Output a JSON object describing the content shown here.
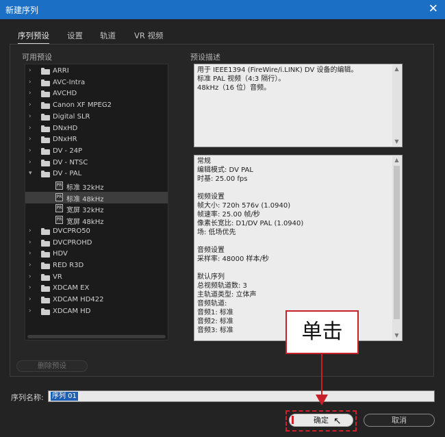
{
  "window": {
    "title": "新建序列",
    "close_glyph": "✕"
  },
  "tabs": [
    {
      "label": "序列预设"
    },
    {
      "label": "设置"
    },
    {
      "label": "轨道"
    },
    {
      "label": "VR 视频"
    }
  ],
  "presets": {
    "section_label": "可用预设",
    "items": [
      {
        "label": "ARRI",
        "type": "folder",
        "expanded": false
      },
      {
        "label": "AVC-Intra",
        "type": "folder",
        "expanded": false
      },
      {
        "label": "AVCHD",
        "type": "folder",
        "expanded": false
      },
      {
        "label": "Canon XF MPEG2",
        "type": "folder",
        "expanded": false
      },
      {
        "label": "Digital SLR",
        "type": "folder",
        "expanded": false
      },
      {
        "label": "DNxHD",
        "type": "folder",
        "expanded": false
      },
      {
        "label": "DNxHR",
        "type": "folder",
        "expanded": false
      },
      {
        "label": "DV - 24P",
        "type": "folder",
        "expanded": false
      },
      {
        "label": "DV - NTSC",
        "type": "folder",
        "expanded": false
      },
      {
        "label": "DV - PAL",
        "type": "folder",
        "expanded": true
      },
      {
        "label": "标准 32kHz",
        "type": "preset"
      },
      {
        "label": "标准 48kHz",
        "type": "preset",
        "selected": true
      },
      {
        "label": "宽屏 32kHz",
        "type": "preset"
      },
      {
        "label": "宽屏 48kHz",
        "type": "preset"
      },
      {
        "label": "DVCPRO50",
        "type": "folder",
        "expanded": false
      },
      {
        "label": "DVCPROHD",
        "type": "folder",
        "expanded": false
      },
      {
        "label": "HDV",
        "type": "folder",
        "expanded": false
      },
      {
        "label": "RED R3D",
        "type": "folder",
        "expanded": false
      },
      {
        "label": "VR",
        "type": "folder",
        "expanded": false
      },
      {
        "label": "XDCAM EX",
        "type": "folder",
        "expanded": false
      },
      {
        "label": "XDCAM HD422",
        "type": "folder",
        "expanded": false
      },
      {
        "label": "XDCAM HD",
        "type": "folder",
        "expanded": false
      }
    ],
    "preset_icon_text": "PR",
    "delete_button": "删除预设"
  },
  "description": {
    "section_label": "预设描述",
    "lines": [
      "用于 IEEE1394 (FireWire/i.LINK) DV 设备的编辑。",
      "标准 PAL 视频（4:3 隔行）。",
      "48kHz（16 位）音频。"
    ]
  },
  "details": {
    "lines": [
      "常规",
      " 编辑模式: DV PAL",
      " 时基: 25.00 fps",
      "",
      "视频设置",
      " 帧大小: 720h 576v (1.0940)",
      " 帧速率: 25.00  帧/秒",
      " 像素长宽比: D1/DV PAL (1.0940)",
      " 场: 低场优先",
      "",
      "音频设置",
      " 采样率: 48000 样本/秒",
      "",
      "默认序列",
      " 总视频轨道数: 3",
      " 主轨道类型: 立体声",
      " 音频轨道:",
      " 音频1: 标准",
      " 音频2: 标准",
      " 音频3: 标准"
    ]
  },
  "sequence_name": {
    "label": "序列名称:",
    "value": "序列 01"
  },
  "buttons": {
    "ok": "确定",
    "cancel": "取消"
  },
  "annotation": {
    "callout": "单击",
    "color": "#c8202a"
  },
  "colors": {
    "titlebar": "#1b6fc4",
    "selection": "#1f5fb3",
    "background": "#232323"
  }
}
